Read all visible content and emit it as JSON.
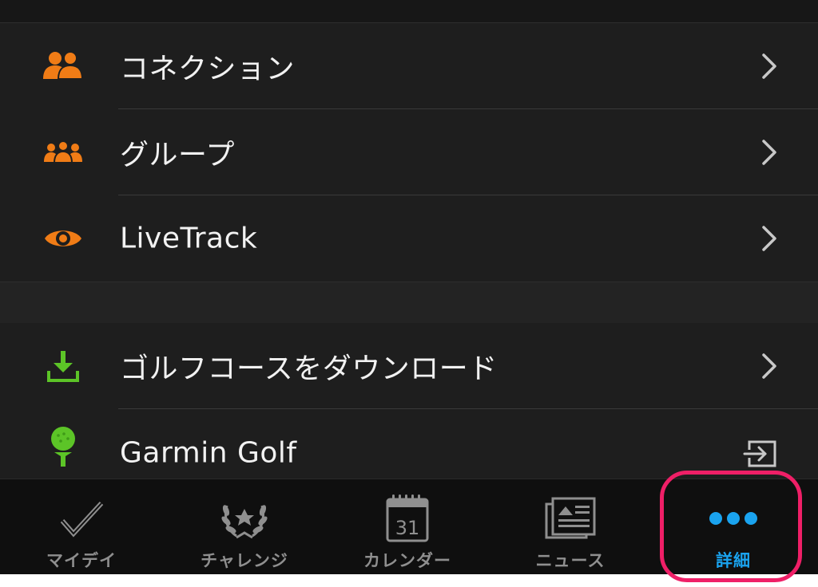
{
  "menu": {
    "section1": [
      {
        "label": "コネクション",
        "icon": "connections-icon"
      },
      {
        "label": "グループ",
        "icon": "groups-icon"
      },
      {
        "label": "LiveTrack",
        "icon": "eye-icon"
      }
    ],
    "section2": [
      {
        "label": "ゴルフコースをダウンロード",
        "icon": "download-icon"
      },
      {
        "label": "Garmin Golf",
        "icon": "golf-ball-icon",
        "trailing": "external-app-icon"
      }
    ]
  },
  "tabs": [
    {
      "label": "マイデイ",
      "icon": "checkmark-icon"
    },
    {
      "label": "チャレンジ",
      "icon": "laurel-icon"
    },
    {
      "label": "カレンダー",
      "icon": "calendar-icon",
      "calendar_day": "31"
    },
    {
      "label": "ニュース",
      "icon": "news-icon"
    },
    {
      "label": "詳細",
      "icon": "more-dots-icon",
      "active": true
    }
  ],
  "colors": {
    "accent_orange": "#f07c16",
    "accent_green": "#5cc427",
    "active_tab": "#1aa3ef",
    "highlight": "#ef1f67"
  }
}
